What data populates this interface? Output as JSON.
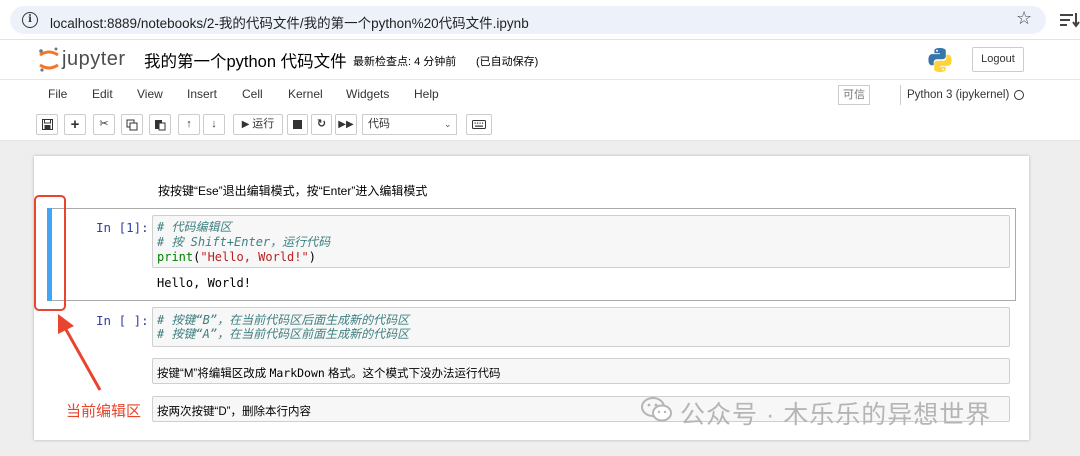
{
  "browser": {
    "url": "localhost:8889/notebooks/2-我的代码文件/我的第一个python%20代码文件.ipynb"
  },
  "header": {
    "logo_text": "jupyter",
    "notebook_title": "我的第一个python 代码文件",
    "checkpoint": "最新检查点: 4 分钟前",
    "autosave": "(已自动保存)",
    "logout_label": "Logout"
  },
  "menubar": {
    "items": [
      "File",
      "Edit",
      "View",
      "Insert",
      "Cell",
      "Kernel",
      "Widgets",
      "Help"
    ],
    "trusted_label": "可信",
    "kernel_label": "Python 3 (ipykernel)"
  },
  "toolbar": {
    "run_label": "运行",
    "cell_type": "代码",
    "icons": [
      "save-icon",
      "plus-icon",
      "scissors-icon",
      "copy-icon",
      "paste-icon",
      "arrow-up-icon",
      "arrow-down-icon",
      "run-icon",
      "stop-icon",
      "restart-icon",
      "fast-forward-icon",
      "keyboard-icon"
    ]
  },
  "notebook": {
    "markdown_text": "按按键“Ese”退出编辑模式，按“Enter”进入编辑模式",
    "cell1": {
      "prompt": "In [1]:",
      "line1": "# 代码编辑区",
      "line2": "# 按 Shift+Enter，运行代码",
      "line3_func": "print",
      "line3_open": "(",
      "line3_string": "\"Hello, World!\"",
      "line3_close": ")",
      "output": "Hello, World!"
    },
    "cell2": {
      "prompt": "In [ ]:",
      "line1": "# 按键“B”，在当前代码区后面生成新的代码区",
      "line2": "# 按键“A”，在当前代码区前面生成新的代码区"
    },
    "cell3": {
      "text_before": "按键“M”将编辑区改成 ",
      "text_mono": "MarkDown",
      "text_after": " 格式。这个模式下没办法运行代码"
    },
    "cell4": {
      "text": "按两次按键“D”，删除本行内容"
    }
  },
  "annotation": {
    "label": "当前编辑区",
    "color": "#e8442e"
  },
  "watermark": {
    "text": "公众号 · 木乐乐的异想世界"
  }
}
